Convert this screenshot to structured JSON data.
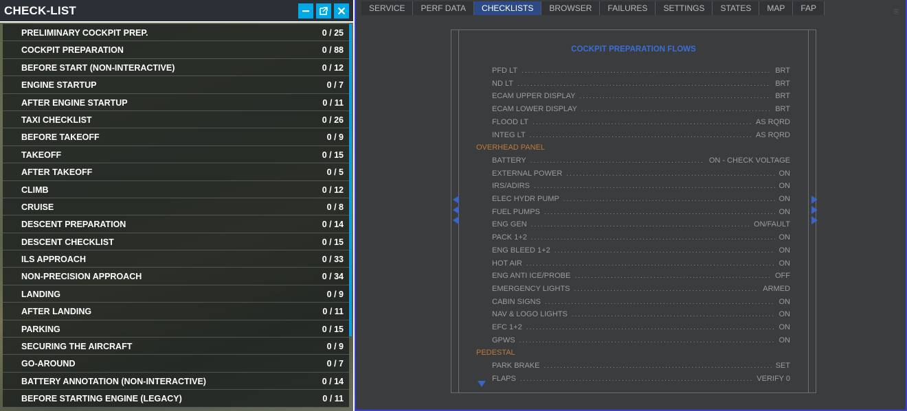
{
  "left_panel": {
    "title": "CHECK-LIST",
    "items": [
      {
        "name": "PRELIMINARY COCKPIT PREP.",
        "count": "0 / 25"
      },
      {
        "name": "COCKPIT PREPARATION",
        "count": "0 / 88"
      },
      {
        "name": "BEFORE START (NON-INTERACTIVE)",
        "count": "0 / 12"
      },
      {
        "name": "ENGINE STARTUP",
        "count": "0 / 7"
      },
      {
        "name": "AFTER ENGINE STARTUP",
        "count": "0 / 11"
      },
      {
        "name": "TAXI CHECKLIST",
        "count": "0 / 26"
      },
      {
        "name": "BEFORE TAKEOFF",
        "count": "0 / 9"
      },
      {
        "name": "TAKEOFF",
        "count": "0 / 15"
      },
      {
        "name": "AFTER TAKEOFF",
        "count": "0 / 5"
      },
      {
        "name": "CLIMB",
        "count": "0 / 12"
      },
      {
        "name": "CRUISE",
        "count": "0 / 8"
      },
      {
        "name": "DESCENT PREPARATION",
        "count": "0 / 14"
      },
      {
        "name": "DESCENT CHECKLIST",
        "count": "0 / 15"
      },
      {
        "name": "ILS APPROACH",
        "count": "0 / 33"
      },
      {
        "name": "NON-PRECISION APPROACH",
        "count": "0 / 34"
      },
      {
        "name": "LANDING",
        "count": "0 / 9"
      },
      {
        "name": "AFTER LANDING",
        "count": "0 / 11"
      },
      {
        "name": "PARKING",
        "count": "0 / 15"
      },
      {
        "name": "SECURING THE AIRCRAFT",
        "count": "0 / 9"
      },
      {
        "name": "GO-AROUND",
        "count": "0 / 7"
      },
      {
        "name": "BATTERY ANNOTATION (NON-INTERACTIVE)",
        "count": "0 / 14"
      },
      {
        "name": "BEFORE STARTING ENGINE (LEGACY)",
        "count": "0 / 11"
      }
    ]
  },
  "right_panel": {
    "tabs": [
      "SERVICE",
      "PERF DATA",
      "CHECKLISTS",
      "BROWSER",
      "FAILURES",
      "SETTINGS",
      "STATES",
      "MAP",
      "FAP"
    ],
    "active_tab": "CHECKLISTS",
    "doc_title": "COCKPIT PREPARATION FLOWS",
    "lines": [
      {
        "kind": "item",
        "item": "PFD LT",
        "value": "BRT"
      },
      {
        "kind": "item",
        "item": "ND LT",
        "value": "BRT"
      },
      {
        "kind": "item",
        "item": "ECAM UPPER DISPLAY",
        "value": "BRT"
      },
      {
        "kind": "item",
        "item": "ECAM LOWER DISPLAY",
        "value": "BRT"
      },
      {
        "kind": "item",
        "item": "FLOOD LT",
        "value": "AS RQRD"
      },
      {
        "kind": "item",
        "item": "INTEG LT",
        "value": "AS RQRD"
      },
      {
        "kind": "section",
        "item": "OVERHEAD PANEL"
      },
      {
        "kind": "item",
        "item": "BATTERY",
        "value": "ON - CHECK VOLTAGE"
      },
      {
        "kind": "item",
        "item": "EXTERNAL POWER",
        "value": "ON"
      },
      {
        "kind": "item",
        "item": "IRS/ADIRS",
        "value": "ON"
      },
      {
        "kind": "item",
        "item": "ELEC HYDR PUMP",
        "value": "ON"
      },
      {
        "kind": "item",
        "item": "FUEL PUMPS",
        "value": "ON"
      },
      {
        "kind": "item",
        "item": "ENG GEN",
        "value": "ON/FAULT"
      },
      {
        "kind": "item",
        "item": "PACK 1+2",
        "value": "ON"
      },
      {
        "kind": "item",
        "item": "ENG BLEED 1+2",
        "value": "ON"
      },
      {
        "kind": "item",
        "item": "HOT AIR",
        "value": "ON"
      },
      {
        "kind": "item",
        "item": "ENG ANTI ICE/PROBE",
        "value": "OFF"
      },
      {
        "kind": "item",
        "item": "EMERGENCY LIGHTS",
        "value": "ARMED"
      },
      {
        "kind": "item",
        "item": "CABIN SIGNS",
        "value": "ON"
      },
      {
        "kind": "item",
        "item": "NAV & LOGO LIGHTS",
        "value": "ON"
      },
      {
        "kind": "item",
        "item": "EFC 1+2",
        "value": "ON"
      },
      {
        "kind": "item",
        "item": "GPWS",
        "value": "ON"
      },
      {
        "kind": "section",
        "item": "PEDESTAL"
      },
      {
        "kind": "item",
        "item": "PARK BRAKE",
        "value": "SET"
      },
      {
        "kind": "item",
        "item": "FLAPS",
        "value": "VERIFY 0"
      }
    ]
  },
  "icons": {
    "minimize": "minimize-icon",
    "popout": "popout-icon",
    "close": "close-icon"
  },
  "colors": {
    "accent_blue": "#00a8e8",
    "doc_title_blue": "#3a6fd8",
    "section_orange": "#c07a3a",
    "active_tab": "#2d4a86"
  }
}
